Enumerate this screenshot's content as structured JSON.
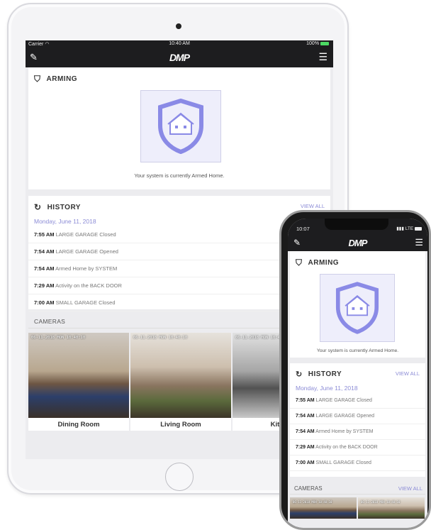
{
  "tablet": {
    "status": {
      "carrier": "Carrier",
      "time": "10:40 AM",
      "battery": "100%"
    },
    "brand": "DMP",
    "arming": {
      "title": "ARMING",
      "status_text": "Your system is currently Armed Home."
    },
    "history": {
      "title": "HISTORY",
      "view_all": "VIEW ALL",
      "date": "Monday, June 11, 2018",
      "events": [
        {
          "time": "7:55 AM",
          "text": "LARGE GARAGE Closed"
        },
        {
          "time": "7:54 AM",
          "text": "LARGE GARAGE Opened"
        },
        {
          "time": "7:54 AM",
          "text": "Armed Home by SYSTEM"
        },
        {
          "time": "7:29 AM",
          "text": "Activity on the BACK DOOR"
        },
        {
          "time": "7:00 AM",
          "text": "SMALL GARAGE Closed"
        }
      ]
    },
    "cameras": {
      "title": "CAMERAS",
      "items": [
        {
          "name": "Dining Room",
          "stamp": "06-11-2018 MON 10:40:10"
        },
        {
          "name": "Living Room",
          "stamp": "06-11-2018 MON 10:40:10"
        },
        {
          "name": "Kitchen",
          "stamp": "06-11-2018 MON 10:40:10"
        }
      ]
    }
  },
  "phone": {
    "status": {
      "time": "10:07",
      "signal": "LTE"
    },
    "brand": "DMP",
    "arming": {
      "title": "ARMING",
      "status_text": "Your system is currently Armed Home."
    },
    "history": {
      "title": "HISTORY",
      "view_all": "VIEW ALL",
      "date": "Monday, June 11, 2018",
      "events": [
        {
          "time": "7:55 AM",
          "text": "LARGE GARAGE Closed"
        },
        {
          "time": "7:54 AM",
          "text": "LARGE GARAGE Opened"
        },
        {
          "time": "7:54 AM",
          "text": "Armed Home by SYSTEM"
        },
        {
          "time": "7:29 AM",
          "text": "Activity on the BACK DOOR"
        },
        {
          "time": "7:00 AM",
          "text": "SMALL GARAGE Closed"
        }
      ]
    },
    "cameras": {
      "title": "CAMERAS",
      "view_all": "VIEW ALL"
    }
  },
  "colors": {
    "accent": "#8c8cd6",
    "shield": "#8a8ae6",
    "app_bar": "#1d1d1f"
  }
}
